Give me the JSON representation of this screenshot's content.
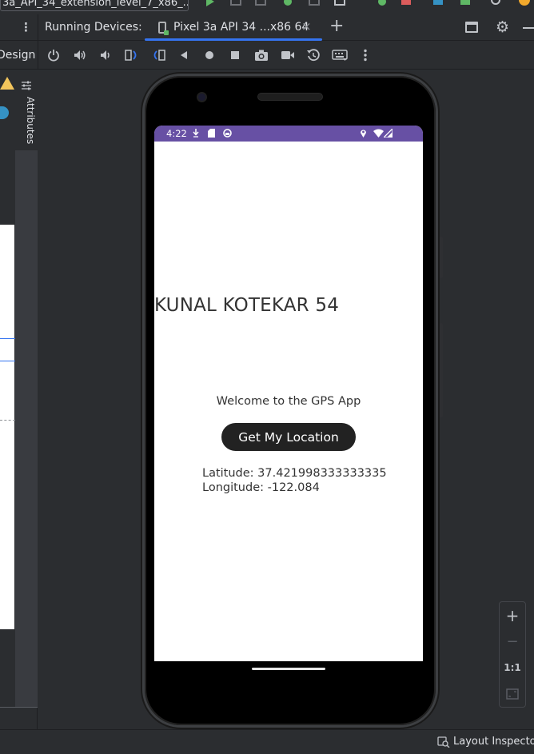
{
  "top_bar": {
    "run_config": "3a_API_34_extension_level_7_x86_..."
  },
  "tab_bar": {
    "title": "Running Devices:",
    "tab_label": "Pixel 3a API 34 ...x86 64",
    "add_tab": "+",
    "close": "×"
  },
  "toolbar": {
    "design_label": "Design",
    "icons": [
      "power-icon",
      "volume-up-icon",
      "volume-down-icon",
      "rotate-left-icon",
      "rotate-right-icon",
      "back-icon",
      "home-icon",
      "overview-icon",
      "screenshot-icon",
      "screen-record-icon",
      "snapshot-icon",
      "keyboard-icon",
      "more-icon"
    ]
  },
  "side_panel": {
    "attributes_label": "Attributes"
  },
  "device": {
    "status_time": "4:22",
    "app": {
      "heading": "KUNAL KOTEKAR 54",
      "welcome": "Welcome to the GPS App",
      "button": "Get My Location",
      "latitude": "Latitude: 37.421998333333335",
      "longitude": "Longitude: -122.084"
    }
  },
  "zoom": {
    "plus": "+",
    "minus": "−",
    "actual": "1:1"
  },
  "status_bar": {
    "layout_inspector": "Layout Inspector"
  },
  "colors": {
    "ide_bg": "#2b2d30",
    "accent": "#3574f0",
    "android_status": "#6750a4",
    "button_bg": "#222222"
  }
}
